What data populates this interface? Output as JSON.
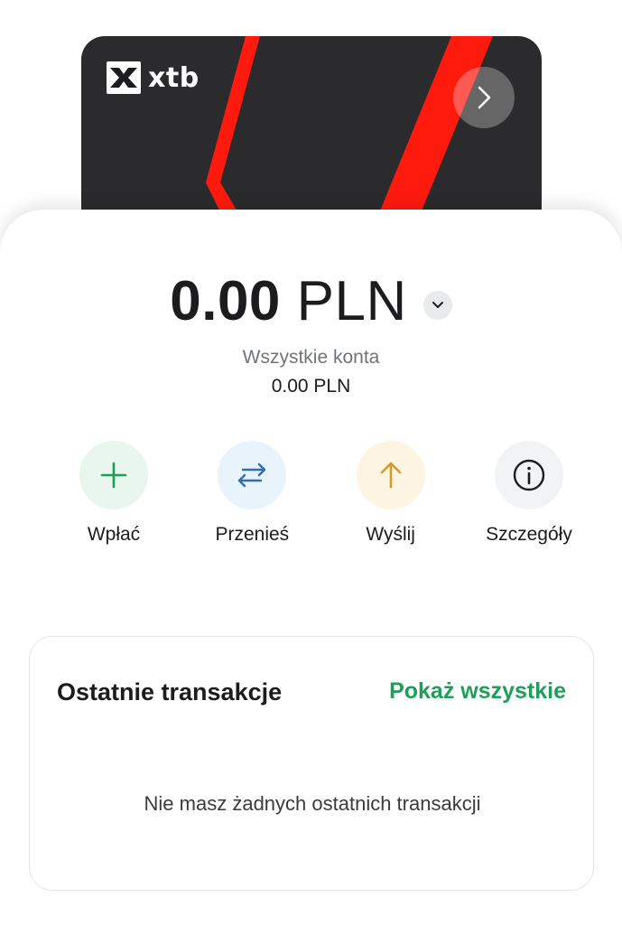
{
  "card": {
    "brand": "xtb",
    "icons": {
      "logo": "xtb-logo-icon",
      "next": "chevron-right-icon"
    }
  },
  "balance": {
    "amount": "0.00",
    "currency": "PLN",
    "dropdown_icon": "chevron-down-icon",
    "accounts_label": "Wszystkie konta",
    "accounts_value": "0.00 PLN"
  },
  "actions": [
    {
      "label": "Wpłać",
      "icon": "plus-icon",
      "color": "#1e9e5a"
    },
    {
      "label": "Przenieś",
      "icon": "transfer-arrows-icon",
      "color": "#2f6fb0"
    },
    {
      "label": "Wyślij",
      "icon": "arrow-up-icon",
      "color": "#d39a2e"
    },
    {
      "label": "Szczegóły",
      "icon": "info-icon",
      "color": "#1c1c1e"
    }
  ],
  "transactions": {
    "title": "Ostatnie transakcje",
    "show_all": "Pokaż wszystkie",
    "empty_message": "Nie masz żadnych ostatnich transakcji"
  },
  "colors": {
    "accent_green": "#1e9e5a",
    "card_dark": "#2b2b2d",
    "card_red": "#ff1a0e"
  }
}
